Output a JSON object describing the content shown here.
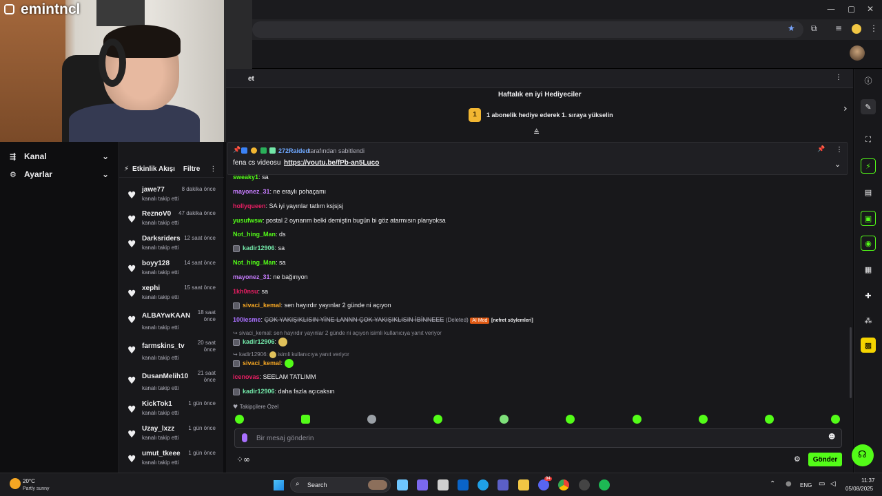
{
  "webcam": {
    "name": "emintncl"
  },
  "left_nav": {
    "items": [
      {
        "label": "Kanal",
        "icon": "channel-icon"
      },
      {
        "label": "Ayarlar",
        "icon": "gear-icon"
      }
    ]
  },
  "feed": {
    "title": "Etkinlik Akışı",
    "filter_label": "Filtre",
    "items": [
      {
        "user": "jawe77",
        "time": "8 dakika önce",
        "desc": "kanalı takip etti"
      },
      {
        "user": "ReznoV0",
        "time": "47 dakika önce",
        "desc": "kanalı takip etti"
      },
      {
        "user": "Darksriders",
        "time": "12 saat önce",
        "desc": "kanalı takip etti"
      },
      {
        "user": "boyy128",
        "time": "14 saat önce",
        "desc": "kanalı takip etti"
      },
      {
        "user": "xephi",
        "time": "15 saat önce",
        "desc": "kanalı takip etti"
      },
      {
        "user": "ALBAYwKAAN",
        "time": "18 saat önce",
        "desc": "kanalı takip etti"
      },
      {
        "user": "farmskins_tv",
        "time": "20 saat önce",
        "desc": "kanalı takip etti"
      },
      {
        "user": "DusanMelih10",
        "time": "21 saat önce",
        "desc": "kanalı takip etti"
      },
      {
        "user": "KickTok1",
        "time": "1 gün önce",
        "desc": "kanalı takip etti"
      },
      {
        "user": "Uzay_lxzz",
        "time": "1 gün önce",
        "desc": "kanalı takip etti"
      },
      {
        "user": "umut_tkeee",
        "time": "1 gün önce",
        "desc": "kanalı takip etti"
      }
    ]
  },
  "chat_header": {
    "title": "et"
  },
  "gifters": {
    "title": "Haftalık en iyi Hediyeciler",
    "rank": "1",
    "text": "1 abonelik hediye ederek 1. sıraya yükselin"
  },
  "pinned": {
    "user": "272Raided",
    "suffix": "tarafından sabitlendi",
    "text": "fena cs videosu",
    "link": "https://youtu.be/fPb-an5Luco"
  },
  "messages": [
    {
      "user": "sweaky1",
      "color": "#53fc18",
      "text": "sa"
    },
    {
      "user": "mayonez_31",
      "color": "#c77dff",
      "text": "ne eraylı pohaçamı"
    },
    {
      "user": "hollyqueen",
      "color": "#e91e63",
      "text": "SA iyi yayınlar tatlım ksjsjsj"
    },
    {
      "user": "yusufwsw",
      "color": "#53fc18",
      "text": "postal 2 oynarım belki demiştin bugün bi göz atarmısın planyoksa"
    },
    {
      "user": "Not_hing_Man",
      "color": "#53fc18",
      "text": "ds"
    },
    {
      "user": "kadir12906",
      "color": "#72e6a8",
      "text": "sa"
    },
    {
      "user": "Not_hing_Man",
      "color": "#53fc18",
      "text": "sa"
    },
    {
      "user": "mayonez_31",
      "color": "#c77dff",
      "text": "ne bağırıyon"
    },
    {
      "user": "1kh0nsu",
      "color": "#e91e63",
      "text": "sa"
    },
    {
      "user": "sivaci_kemal",
      "color": "#f5a623",
      "text": "sen hayırdır yayınlar 2 günde ni açıyon"
    },
    {
      "user": "100iesme",
      "color": "#a970ff",
      "text": "ÇOK YAKIŞIKLISIN YİNE LANNN ÇOK YAKIŞIKLISIN İBİNNEEE",
      "deleted": "(Deleted)",
      "mod_tag": "AI Mod",
      "reason": "[nefret söylemleri]"
    },
    {
      "reply": "sivaci_kemal: sen hayırdır yayınlar 2 günde ni açıyon isimli kullanıcıya yanıt veriyor",
      "user": "kadir12906",
      "color": "#72e6a8",
      "text": ""
    },
    {
      "reply": "kadir12906:",
      "reply_suffix": "isimli kullanıcıya yanıt veriyor",
      "user": "sivaci_kemal",
      "color": "#f5a623",
      "text": ""
    },
    {
      "user": "icenovas",
      "color": "#e91e63",
      "text": "SEELAM TATLIMM"
    },
    {
      "user": "kadir12906",
      "color": "#72e6a8",
      "text": "daha fazla açıcaksın"
    }
  ],
  "emote_section": "Takipçilere Özel",
  "input": {
    "placeholder": "Bir mesaj gönderin"
  },
  "send_label": "Gönder",
  "taskbar": {
    "weather_temp": "20°C",
    "weather_desc": "Partly sunny",
    "search": "Search",
    "lang": "ENG",
    "time": "11:37",
    "date": "05/08/2025",
    "discord_badge": "94"
  }
}
